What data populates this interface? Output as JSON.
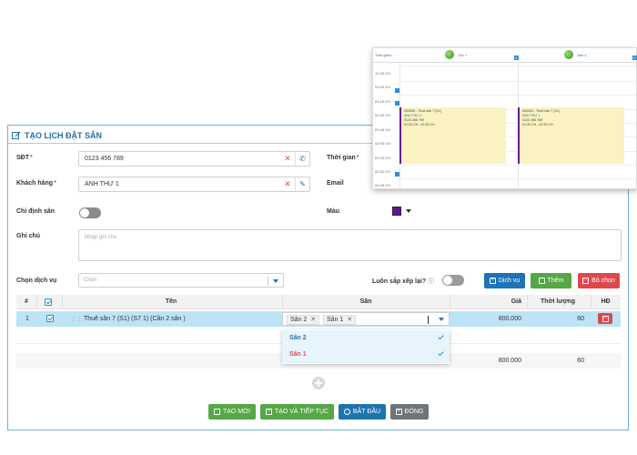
{
  "dialog": {
    "title": "TẠO LỊCH ĐẶT SÂN",
    "labels": {
      "phone": "SĐT",
      "customer": "Khách hàng",
      "assign_court": "Chỉ định sân",
      "note": "Ghi chú",
      "service": "Chọn dịch vụ",
      "time": "Thời gian",
      "email": "Email",
      "color": "Màu",
      "always_arrange": "Luôn sắp xếp lại?"
    },
    "required_mark": "*",
    "phone_value": "0123 456 789",
    "customer_value": "ANH THƯ 1",
    "note_placeholder": "Nhập ghi chú",
    "service_placeholder": "Chọn",
    "color_value": "#5b1a8c",
    "buttons": {
      "service": "Dịch vụ",
      "add": "Thêm",
      "deselect": "Bỏ chọn"
    },
    "footer": {
      "create": "TẠO MỚI",
      "create_continue": "TẠO VÀ TIẾP TỤC",
      "start": "BẮT ĐẦU",
      "close": "ĐÓNG"
    }
  },
  "table": {
    "headers": {
      "index": "#",
      "name": "Tên",
      "court": "Sân",
      "price": "Giá",
      "duration": "Thời lượng",
      "action": "HĐ"
    },
    "rows": [
      {
        "index": "1",
        "name": "Thuê sân 7 (S1) (S7 1) (Cần 2 sân )",
        "courts": [
          "Sân 2",
          "Sân 1"
        ],
        "price": "800.000",
        "duration": "60"
      }
    ],
    "total": {
      "price": "800.000",
      "duration": "60"
    },
    "dropdown": [
      {
        "name": "Sân 2",
        "color": "#1f74b0"
      },
      {
        "name": "Sân 1",
        "color": "#d9534f"
      }
    ]
  },
  "schedule": {
    "time_label": "Thời gian/...",
    "courts": [
      {
        "name": "Sân 1",
        "badge": "1"
      },
      {
        "name": "Sân 2",
        "badge": "2"
      }
    ],
    "slots": [
      "12:45 CH",
      "01:00 CH",
      "01:15 CH",
      "01:30 CH",
      "01:45 CH",
      "02:00 CH",
      "02:15 CH",
      "02:30 CH",
      "02:45 CH"
    ],
    "bookings": [
      {
        "line1": "000065 - Thuê sân 7 (S1)",
        "name": "ANH THƯ 1",
        "phone": "0123 456 789",
        "time": "01:30 CH - 02:30 CH"
      },
      {
        "line1": "000063 - Thuê sân 7 (S1)",
        "name": "ANH THƯ 1",
        "phone": "0123 456 789",
        "time": "01:30 CH - 02:30 CH"
      }
    ]
  }
}
